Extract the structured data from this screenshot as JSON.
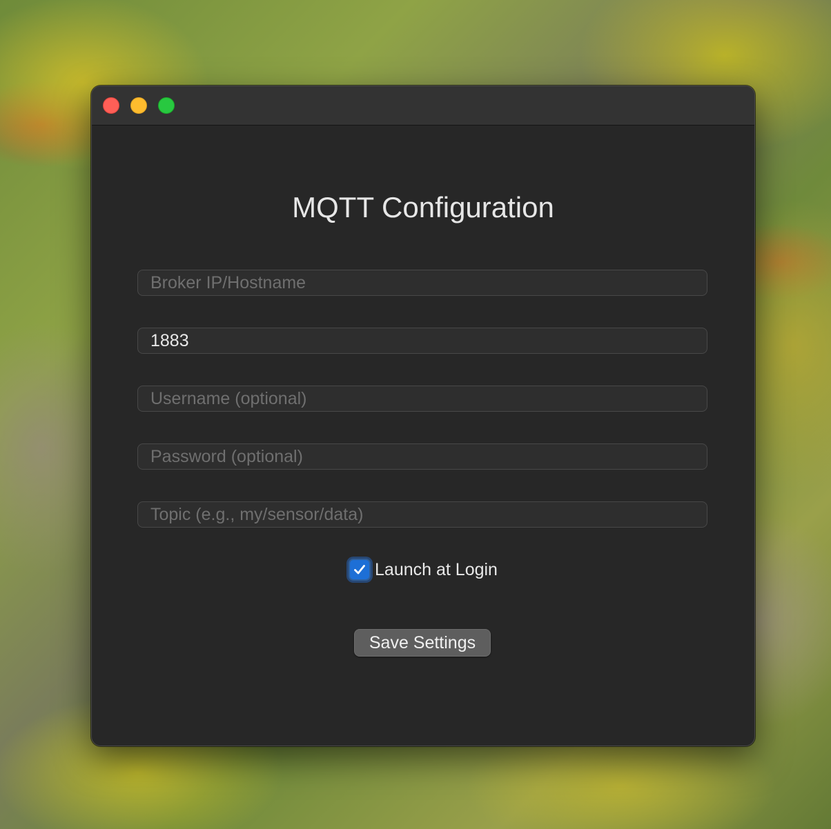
{
  "window": {
    "title": "MQTT Configuration"
  },
  "form": {
    "broker": {
      "value": "",
      "placeholder": "Broker IP/Hostname"
    },
    "port": {
      "value": "1883",
      "placeholder": ""
    },
    "username": {
      "value": "",
      "placeholder": "Username (optional)"
    },
    "password": {
      "value": "",
      "placeholder": "Password (optional)"
    },
    "topic": {
      "value": "",
      "placeholder": "Topic (e.g., my/sensor/data)"
    },
    "launch_at_login": {
      "label": "Launch at Login",
      "checked": true
    },
    "save_label": "Save Settings"
  },
  "colors": {
    "window_bg": "#272727",
    "titlebar_bg": "#333333",
    "close": "#ff5f57",
    "minimize": "#febc2e",
    "maximize": "#28c840",
    "accent": "#1d6fd6"
  },
  "icons": {
    "checkbox": "checkmark-icon"
  }
}
